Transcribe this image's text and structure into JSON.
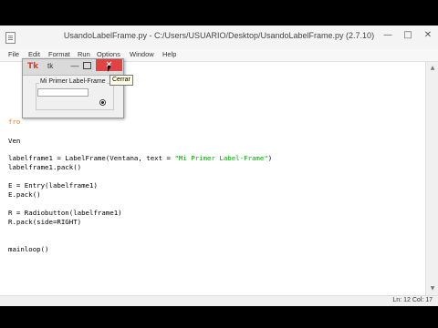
{
  "window": {
    "title": "UsandoLabelFrame.py - C:/Users/USUARIO/Desktop/UsandoLabelFrame.py (2.7.10)",
    "minimize_glyph": "—",
    "maximize_glyph": "□",
    "close_glyph": "✕"
  },
  "menu": {
    "items": [
      {
        "label": "File"
      },
      {
        "label": "Edit"
      },
      {
        "label": "Format"
      },
      {
        "label": "Run"
      },
      {
        "label": "Options"
      },
      {
        "label": "Window"
      },
      {
        "label": "Help"
      }
    ]
  },
  "editor": {
    "lines": [
      {
        "text": "fro"
      },
      {
        "text": ""
      },
      {
        "text": "Ven"
      },
      {
        "text": ""
      },
      {
        "text": "labelframe1 = LabelFrame(Ventana, text = ",
        "str": "\"Mi Primer Label-Frame\"",
        "tail": ")"
      },
      {
        "text": "labelframe1.pack()"
      },
      {
        "text": ""
      },
      {
        "text": "E = Entry(labelframe1)"
      },
      {
        "text": "E.pack()"
      },
      {
        "text": ""
      },
      {
        "text": "R = Radiobutton(labelframe1)"
      },
      {
        "text": "R.pack(side=RIGHT)"
      },
      {
        "text": ""
      },
      {
        "text": ""
      },
      {
        "text": "mainloop()"
      }
    ]
  },
  "status": {
    "text": "Ln: 12 Col: 17"
  },
  "tk_window": {
    "logo": "Tk",
    "title": "tk",
    "close_glyph": "✕",
    "labelframe_text": "Mi Primer Label-Frame"
  },
  "tooltip": {
    "text": "Cerrar"
  },
  "colors": {
    "string": "#00aa00",
    "keyword": "#ff7700",
    "close_button": "#e04343"
  }
}
